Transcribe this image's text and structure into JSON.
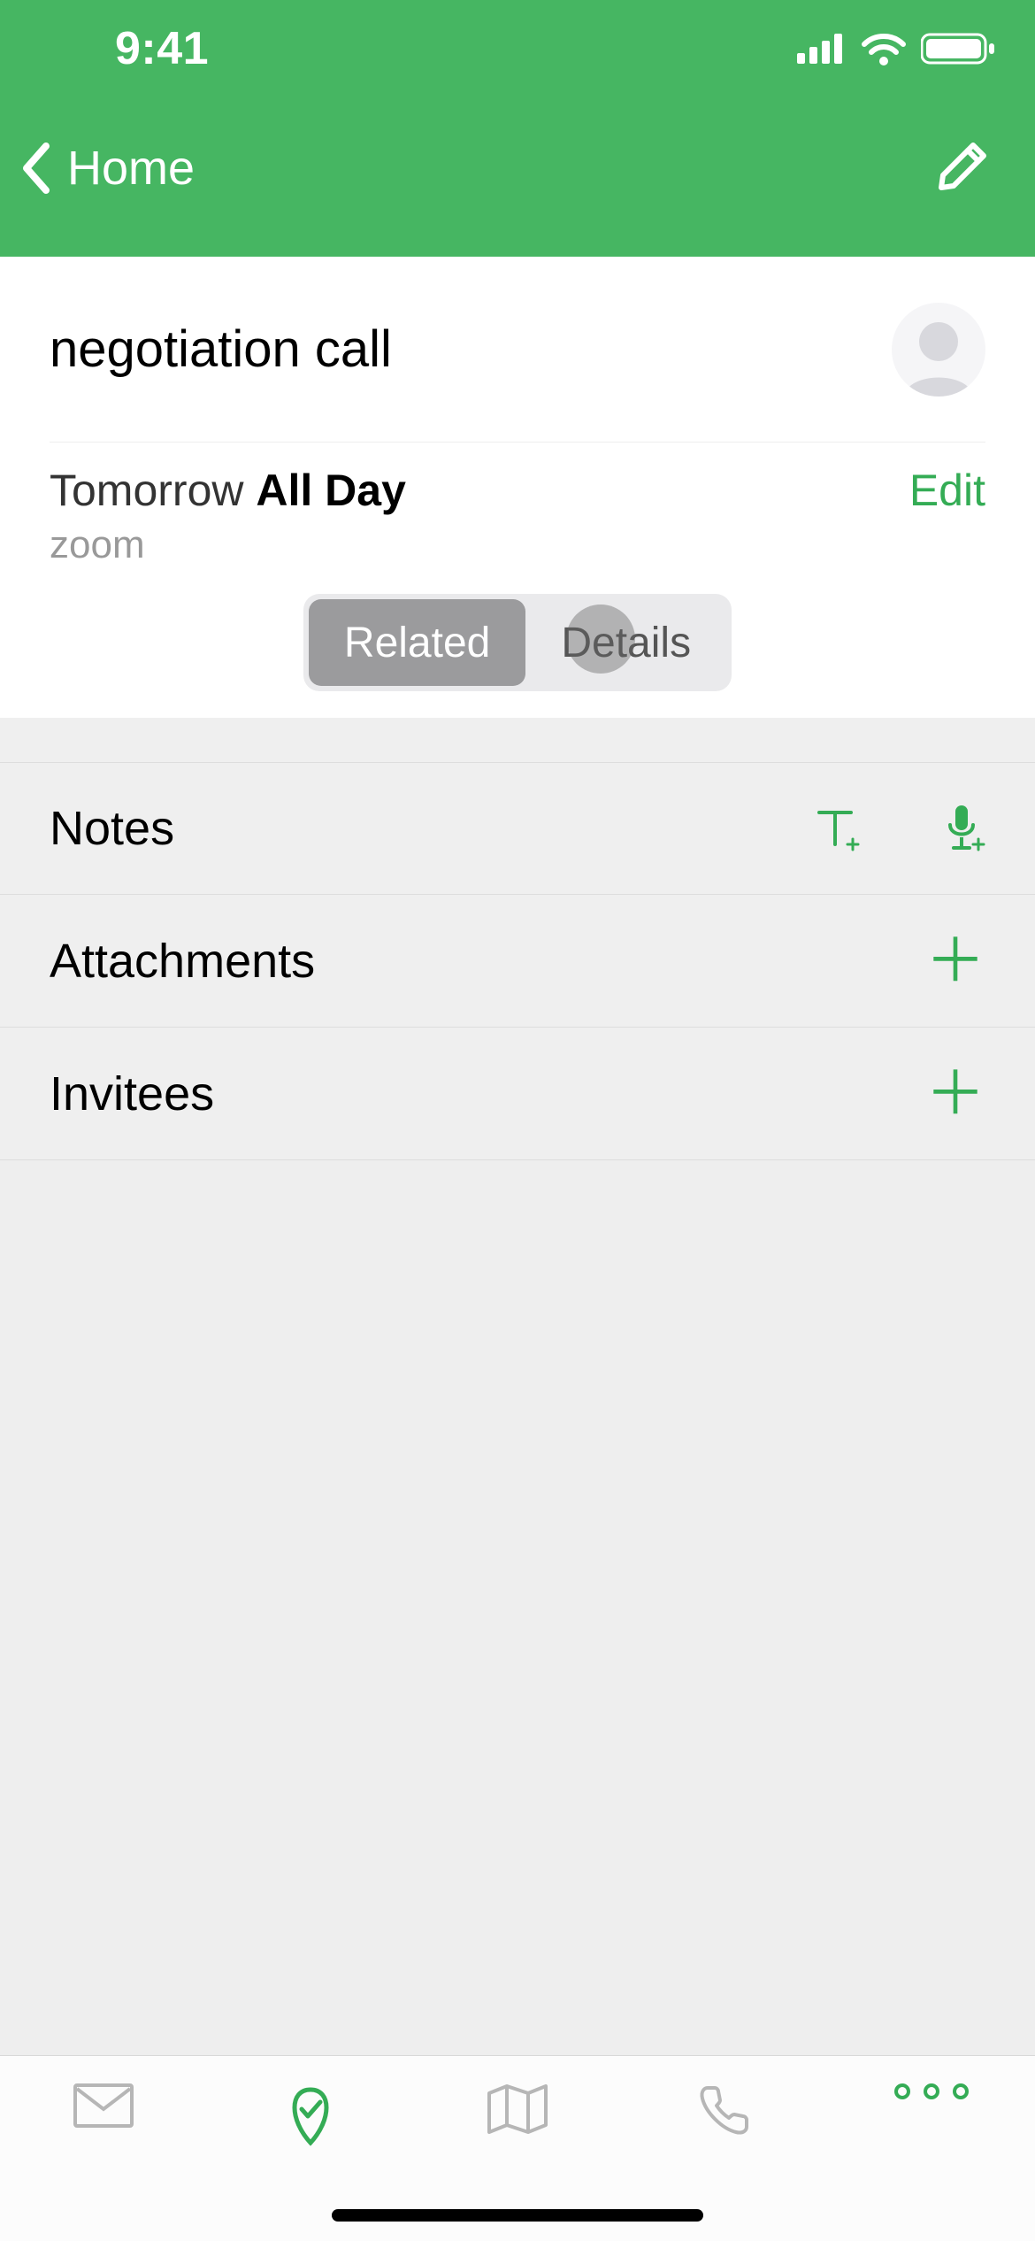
{
  "status_bar": {
    "time": "9:41"
  },
  "header": {
    "back_label": "Home"
  },
  "event": {
    "title": "negotiation call",
    "date_prefix": "Tomorrow",
    "all_day": "All Day",
    "location": "zoom",
    "edit_label": "Edit"
  },
  "segmented": {
    "related": "Related",
    "details": "Details"
  },
  "sections": {
    "notes": "Notes",
    "attachments": "Attachments",
    "invitees": "Invitees"
  },
  "colors": {
    "accent": "#34ac55",
    "header_bg": "#46b662"
  }
}
